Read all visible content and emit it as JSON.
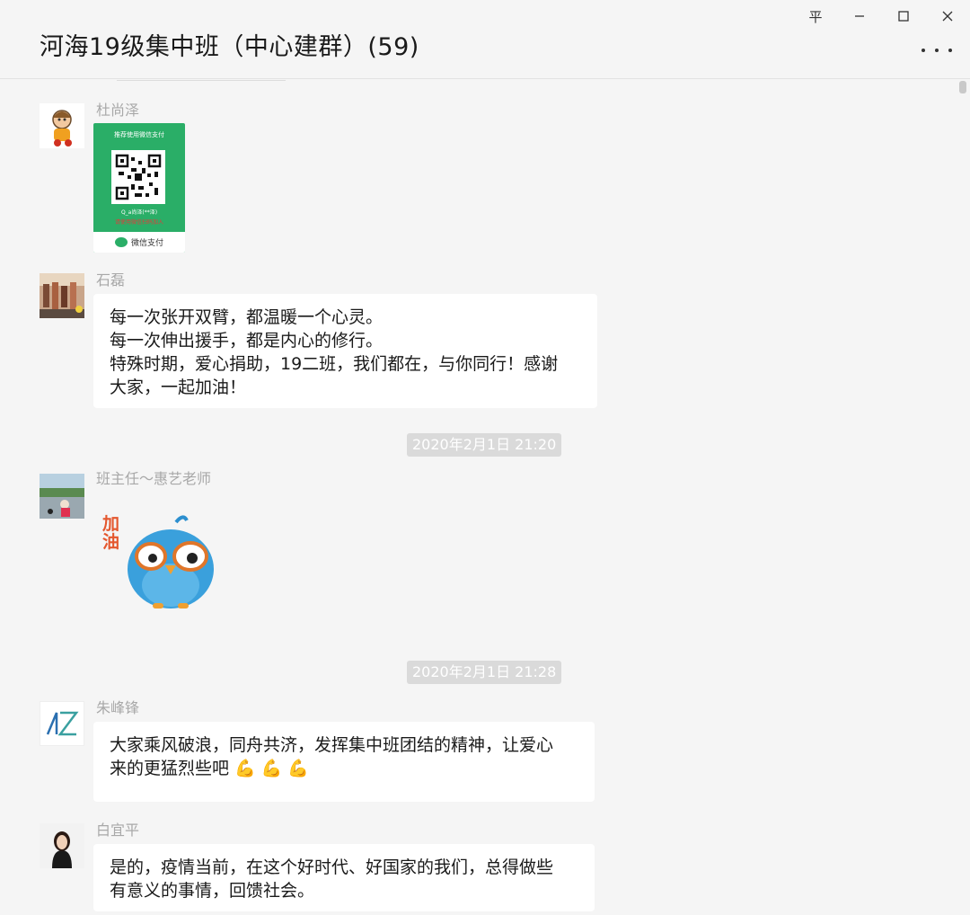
{
  "window": {
    "title": "河海19级集中班（中心建群）(59)",
    "pin_glyph": "平",
    "minimize_glyph": "—",
    "maximize_glyph": "☐",
    "close_glyph": "✕"
  },
  "messages": [
    {
      "sender": "杜尚泽",
      "type": "image",
      "paycard": {
        "header": "推荐使用微信支付",
        "name": "Q_a尚泽(**泽)",
        "red_text": "请使用微信扫码加入",
        "footer": "微信支付"
      }
    },
    {
      "sender": "石磊",
      "type": "text",
      "text": "每一次张开双臂，都温暖一个心灵。\n每一次伸出援手，都是内心的修行。\n特殊时期，爱心捐助，19二班，我们都在，与你同行！感谢\n大家，一起加油！"
    },
    {
      "type": "time",
      "text": "2020年2月1日 21:20"
    },
    {
      "sender": "班主任～惠艺老师",
      "type": "sticker",
      "sticker_text": "加\n油"
    },
    {
      "type": "time",
      "text": "2020年2月1日 21:28"
    },
    {
      "sender": "朱峰锋",
      "type": "text",
      "text": "大家乘风破浪，同舟共济，发挥集中班团结的精神，让爱心\n来的更猛烈些吧 💪 💪 💪"
    },
    {
      "sender": "白宜平",
      "type": "text",
      "text": "是的，疫情当前，在这个好时代、好国家的我们，总得做些\n有意义的事情，回馈社会。"
    }
  ],
  "colors": {
    "background": "#f5f5f5",
    "bubble": "#ffffff",
    "time_tag": "#dadada",
    "sender_text": "#a8a8a8",
    "wechat_green": "#2aae67"
  }
}
